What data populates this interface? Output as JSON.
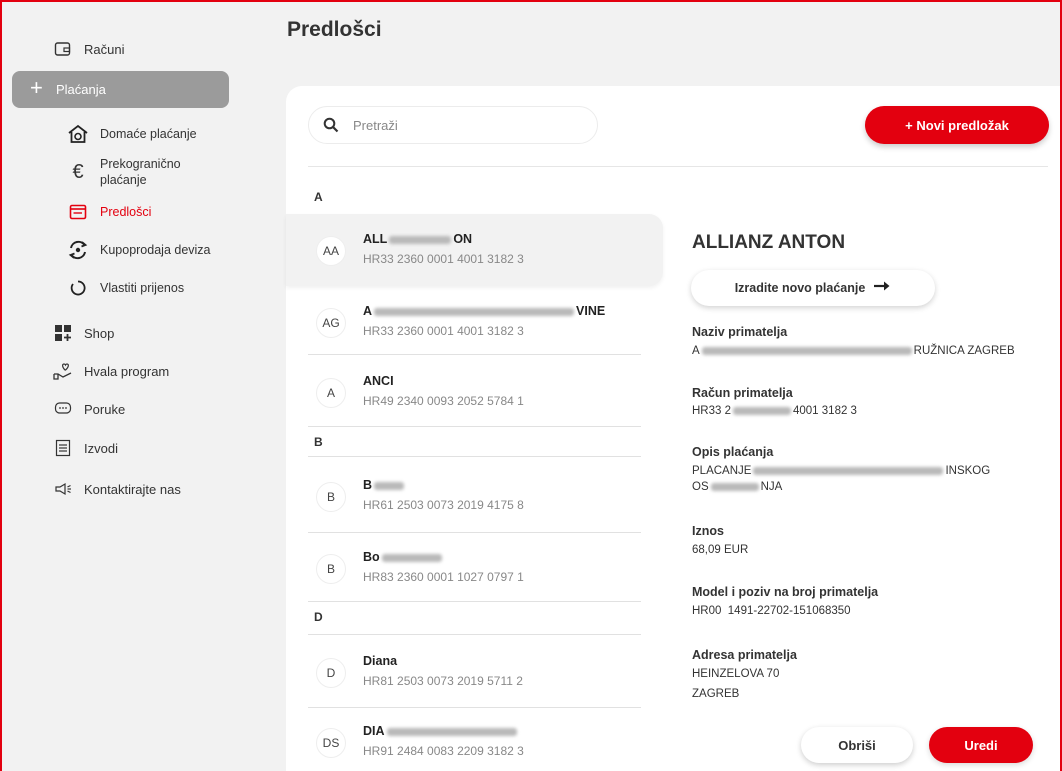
{
  "page_title": "Predlošci",
  "colors": {
    "accent": "#e3000f",
    "sidebar_active": "#9b9b9b"
  },
  "sidebar": {
    "accounts": "Računi",
    "payments": "Plaćanja",
    "sub": {
      "domestic": "Domaće plaćanje",
      "crossborder_1": "Prekogranično",
      "crossborder_2": "plaćanje",
      "templates": "Predlošci",
      "fx": "Kupoprodaja deviza",
      "own_transfer": "Vlastiti prijenos"
    },
    "shop": "Shop",
    "hvala": "Hvala program",
    "messages": "Poruke",
    "statements": "Izvodi",
    "contact": "Kontaktirajte nas"
  },
  "search": {
    "placeholder": "Pretraži"
  },
  "new_template_button": "+ Novi predložak",
  "list": {
    "letters": [
      "A",
      "B",
      "D"
    ],
    "items": [
      {
        "initials": "AA",
        "name_start": "ALL",
        "name_end": "ON",
        "iban": "HR33 2360 0001 4001 3182 3"
      },
      {
        "initials": "AG",
        "name_start": "A",
        "name_end": "VINE",
        "iban": "HR33 2360 0001 4001 3182 3"
      },
      {
        "initials": "A",
        "name": "ANCI",
        "iban": "HR49 2340 0093 2052 5784 1"
      },
      {
        "initials": "B",
        "name_start": "B",
        "iban": "HR61 2503 0073 2019 4175 8"
      },
      {
        "initials": "B",
        "name_start": "Bo",
        "iban": "HR83 2360 0001 1027 0797 1"
      },
      {
        "initials": "D",
        "name": "Diana",
        "iban": "HR81 2503 0073 2019 5711 2"
      },
      {
        "initials": "DS",
        "name_start": "DIA",
        "iban": "HR91 2484 0083 2209 3182 3"
      }
    ]
  },
  "detail": {
    "title": "ALLIANZ ANTON",
    "create_payment_button": "Izradite novo plaćanje",
    "recipient_name_label": "Naziv primatelja",
    "recipient_name_start": "A",
    "recipient_name_end": "RUŽNICA ZAGREB",
    "recipient_account_label": "Račun primatelja",
    "recipient_account_start": "HR33 2",
    "recipient_account_end": "4001 3182 3",
    "description_label": "Opis plaćanja",
    "description_line1_start": "PLACANJE",
    "description_line1_end": "INSKOG",
    "description_line2_start": "OS",
    "description_line2_end": "NJA",
    "amount_label": "Iznos",
    "amount": "68,09 EUR",
    "model_label": "Model i poziv na broj primatelja",
    "model": "HR00  1491-22702-151068350",
    "address_label": "Adresa primatelja",
    "address_line1": "HEINZELOVA 70",
    "address_line2": "ZAGREB"
  },
  "delete_button": "Obriši",
  "edit_button": "Uredi"
}
